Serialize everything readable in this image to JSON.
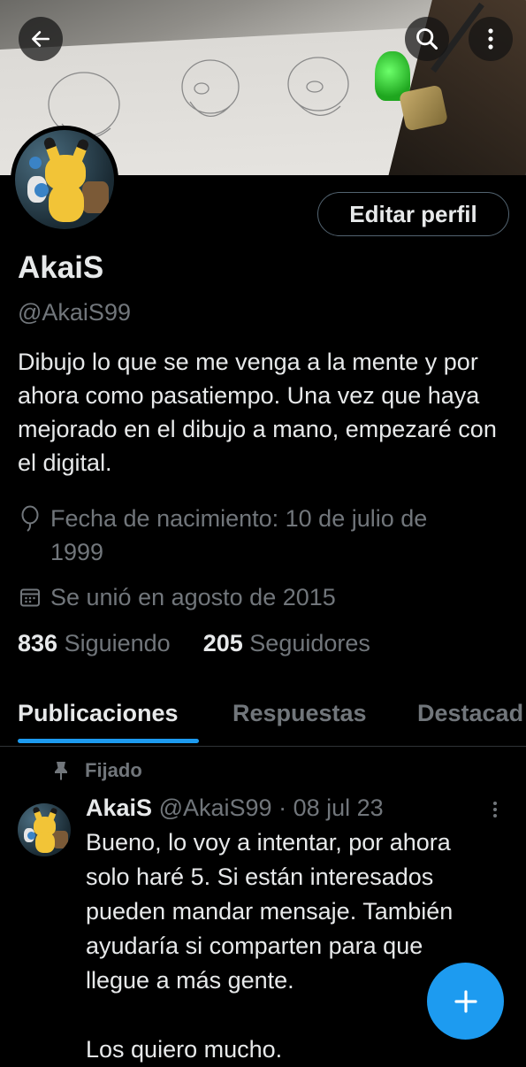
{
  "profile": {
    "name": "AkaiS",
    "handle": "@AkaiS99",
    "bio": "Dibujo lo que se me venga a la mente y por ahora como pasatiempo. Una vez que haya mejorado en el dibujo a mano, empezaré con el digital.",
    "birth_line_1": "Fecha de nacimiento: 10 de julio de",
    "birth_line_2": "1999",
    "joined": "Se unió en agosto de 2015",
    "following_count": "836",
    "following_label": "Siguiendo",
    "followers_count": "205",
    "followers_label": "Seguidores"
  },
  "header": {
    "back_icon": "arrow-left-icon",
    "search_icon": "search-icon",
    "more_icon": "more-vertical-icon",
    "edit_profile_label": "Editar perfil"
  },
  "tabs": [
    {
      "label": "Publicaciones",
      "active": true
    },
    {
      "label": "Respuestas",
      "active": false
    },
    {
      "label": "Destacad",
      "active": false
    }
  ],
  "pinned_post": {
    "pinned_label": "Fijado",
    "author_name": "AkaiS",
    "author_handle": "@AkaiS99",
    "separator": "·",
    "date": "08 jul 23",
    "text_lines": [
      "Bueno, lo voy a intentar, por ahora",
      "solo haré 5. Si están interesados",
      "pueden mandar mensaje. También",
      "ayudaría si comparten para que",
      "llegue a más gente.",
      "",
      "Los quiero mucho."
    ]
  },
  "fab": {
    "icon": "plus-icon"
  },
  "colors": {
    "background": "#000000",
    "text_primary": "#e7e9ea",
    "text_secondary": "#71767b",
    "accent": "#1d9bf0",
    "border": "#2f3336"
  }
}
